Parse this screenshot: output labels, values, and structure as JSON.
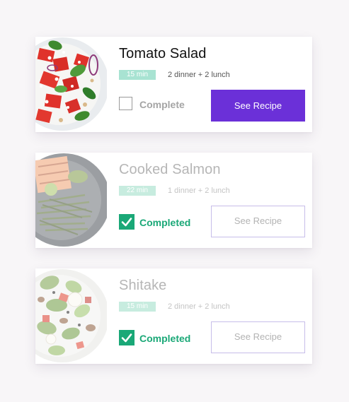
{
  "recipes": [
    {
      "title": "Tomato Salad",
      "time": "15 min",
      "servings": "2 dinner + 2 lunch",
      "status": "Complete",
      "completed": false,
      "button": "See Recipe",
      "image_icon": "tomato-salad-photo"
    },
    {
      "title": "Cooked Salmon",
      "time": "22 min",
      "servings": "1 dinner + 2 lunch",
      "status": "Completed",
      "completed": true,
      "button": "See Recipe",
      "image_icon": "salmon-photo"
    },
    {
      "title": "Shitake",
      "time": "15 min",
      "servings": "2 dinner + 2 lunch",
      "status": "Completed",
      "completed": true,
      "button": "See Recipe",
      "image_icon": "shitake-salad-photo"
    }
  ],
  "colors": {
    "accent_purple": "#6b30d8",
    "complete_green": "#1aa877",
    "time_badge": "#a8e3d2"
  }
}
